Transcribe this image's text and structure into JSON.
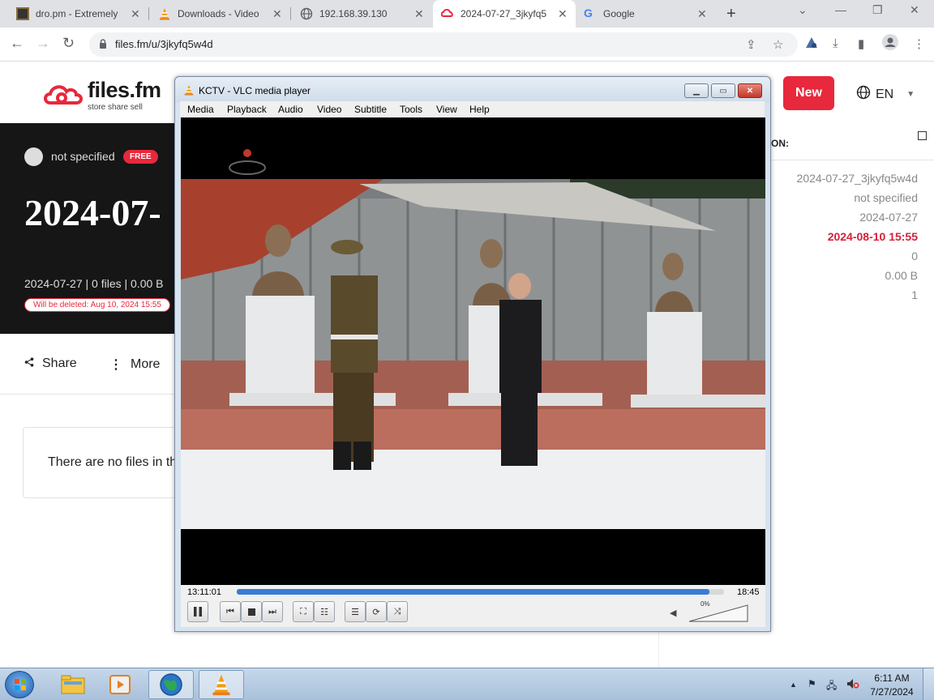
{
  "browser": {
    "tabs": [
      {
        "title": "dro.pm - Extremely",
        "icon": "dro-favicon"
      },
      {
        "title": "Downloads - Video",
        "icon": "vlc-favicon"
      },
      {
        "title": "192.168.39.130",
        "icon": "globe-favicon"
      },
      {
        "title": "2024-07-27_3jkyfq5",
        "icon": "filesfm-favicon",
        "active": true
      },
      {
        "title": "Google",
        "icon": "google-favicon"
      }
    ],
    "url": "files.fm/u/3jkyfq5w4d"
  },
  "site": {
    "logo_name": "files.fm",
    "logo_tagline": "store share sell",
    "new_button": "New",
    "lang": "EN",
    "owner": "not specified",
    "free_badge": "FREE",
    "title": "2024-07-",
    "meta": "2024-07-27 | 0 files | 0.00  B",
    "delete_notice": "Will be deleted: Aug 10, 2024 15:55",
    "share": "Share",
    "more": "More",
    "empty_msg": "There are no files in th",
    "panel_header": "ON:",
    "panel_values": [
      "2024-07-27_3jkyfq5w4d",
      "not specified",
      "2024-07-27",
      "2024-08-10 15:55",
      "0",
      "0.00  B",
      "1"
    ]
  },
  "vlc": {
    "title": "KCTV - VLC media player",
    "menus": [
      "Media",
      "Playback",
      "Audio",
      "Video",
      "Subtitle",
      "Tools",
      "View",
      "Help"
    ],
    "elapsed": "13:11:01",
    "remaining": "18:45",
    "progress": 0.97,
    "volume_pct": "0%"
  },
  "taskbar": {
    "time": "6:11 AM",
    "date": "7/27/2024"
  }
}
